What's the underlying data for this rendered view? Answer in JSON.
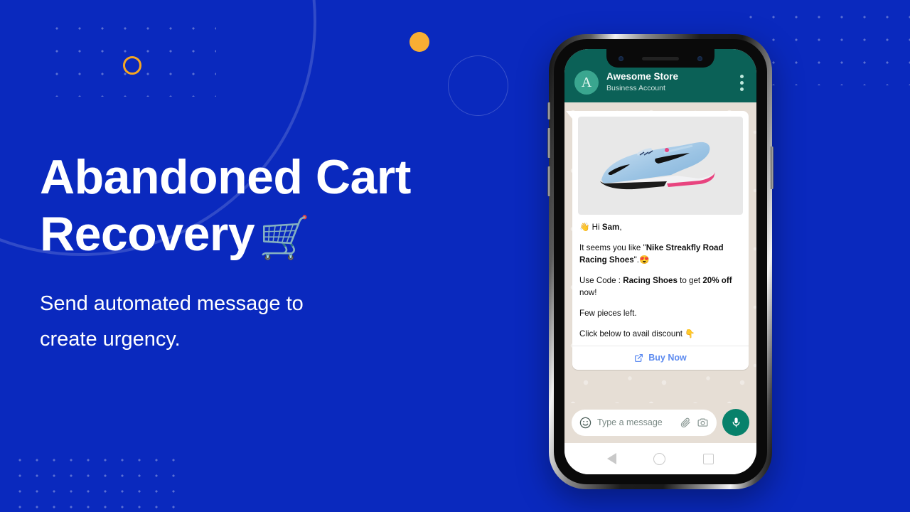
{
  "theme": {
    "background_blue": "#0A29BE",
    "accent_orange": "#F8AE33",
    "whatsapp_header_green": "#0B6157",
    "mic_green": "#07816B",
    "link_blue": "#5D8BF0",
    "chat_bg": "#E6DED5"
  },
  "hero": {
    "headline_line1": "Abandoned Cart",
    "headline_line2": "Recovery",
    "headline_emoji": "🛒",
    "subtitle_line1": "Send automated message to",
    "subtitle_line2": " create urgency."
  },
  "phone": {
    "header": {
      "avatar_letter": "A",
      "store_name": "Awesome Store",
      "account_type": "Business Account",
      "menu_icon": "kebab-menu-icon"
    },
    "message": {
      "media_alt": "nike-streakfly-road-racing-shoe-photo",
      "greeting_emoji": "👋",
      "greeting_prefix": "Hi ",
      "greeting_name": "Sam",
      "greeting_suffix": ",",
      "line2_prefix": "It seems you like \"",
      "line2_product": "Nike Streakfly Road Racing Shoes",
      "line2_suffix": "\".",
      "line2_emoji": "😍",
      "line3_prefix": "Use Code : ",
      "line3_code": "Racing Shoes",
      "line3_mid": " to get ",
      "line3_discount": "20% off",
      "line3_suffix": " now!",
      "line4": "Few pieces left.",
      "line5": "Click below to avail discount ",
      "line5_emoji": "👇",
      "cta_label": "Buy Now",
      "cta_icon": "external-link-icon"
    },
    "input_bar": {
      "emoji_icon": "smiley-icon",
      "placeholder": "Type a message",
      "attach_icon": "paperclip-icon",
      "camera_icon": "camera-icon",
      "mic_icon": "microphone-icon"
    },
    "nav_bar": {
      "back_icon": "back-triangle-icon",
      "home_icon": "home-circle-icon",
      "recents_icon": "recents-square-icon"
    }
  }
}
